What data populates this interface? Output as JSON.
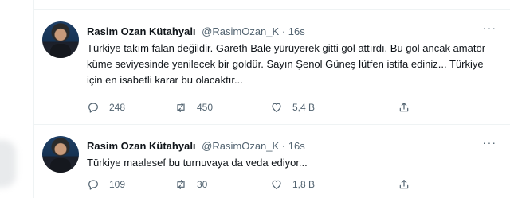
{
  "tweets": [
    {
      "name": "Rasim Ozan Kütahyalı",
      "handle": "@RasimOzan_K",
      "dot": "·",
      "time": "16s",
      "more": "···",
      "text": "Türkiye takım falan değildir. Gareth Bale yürüyerek gitti gol attırdı. Bu gol ancak amatör küme seviyesinde yenilecek bir goldür. Sayın Şenol Güneş lütfen istifa ediniz... Türkiye için en isabetli karar bu olacaktır...",
      "replies": "248",
      "retweets": "450",
      "likes": "5,4 B"
    },
    {
      "name": "Rasim Ozan Kütahyalı",
      "handle": "@RasimOzan_K",
      "dot": "·",
      "time": "16s",
      "more": "···",
      "text": "Türkiye maalesef bu turnuvaya da veda ediyor...",
      "replies": "109",
      "retweets": "30",
      "likes": "1,8 B"
    }
  ],
  "icons": {
    "reply": "reply-icon",
    "retweet": "retweet-icon",
    "like": "like-icon",
    "share": "share-icon"
  }
}
